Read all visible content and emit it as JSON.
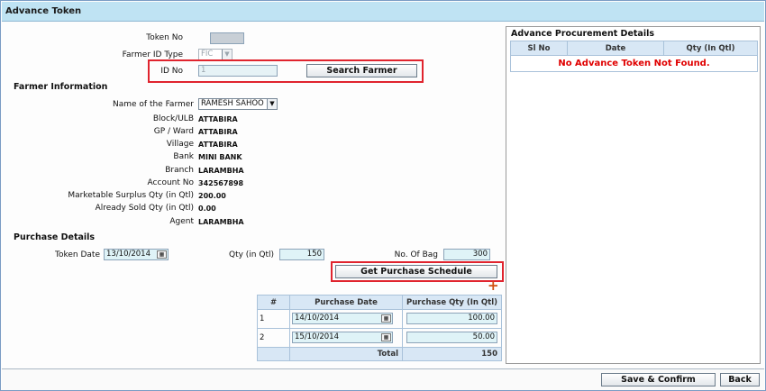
{
  "window": {
    "title": "Advance Token"
  },
  "token": {
    "label": "Token No",
    "value": ""
  },
  "farmer_id_type": {
    "label": "Farmer ID Type",
    "value": "FIC"
  },
  "id_no": {
    "label": "ID No",
    "value": "1"
  },
  "search_farmer": {
    "label": "Search Farmer"
  },
  "farmer_info": {
    "heading": "Farmer Information",
    "name_label": "Name of the Farmer",
    "name_value": "RAMESH SAHOO",
    "fields": [
      {
        "label": "Block/ULB",
        "value": "ATTABIRA"
      },
      {
        "label": "GP / Ward",
        "value": "ATTABIRA"
      },
      {
        "label": "Village",
        "value": "ATTABIRA"
      },
      {
        "label": "Bank",
        "value": "MINI BANK"
      },
      {
        "label": "Branch",
        "value": "LARAMBHA"
      },
      {
        "label": "Account No",
        "value": "342567898"
      },
      {
        "label": "Marketable Surplus Qty (in Qtl)",
        "value": "200.00"
      },
      {
        "label": "Already Sold Qty (in Qtl)",
        "value": "0.00"
      },
      {
        "label": "Agent",
        "value": "LARAMBHA"
      }
    ]
  },
  "purchase": {
    "heading": "Purchase Details",
    "token_date_label": "Token Date",
    "token_date_value": "13/10/2014",
    "qty_label": "Qty (in Qtl)",
    "qty_value": "150",
    "bags_label": "No. Of Bag",
    "bags_value": "300",
    "schedule_button": "Get Purchase Schedule"
  },
  "schedule_table": {
    "headers": [
      "#",
      "Purchase Date",
      "Purchase Qty (In Qtl)"
    ],
    "rows": [
      {
        "no": "1",
        "date": "14/10/2014",
        "qty": "100.00"
      },
      {
        "no": "2",
        "date": "15/10/2014",
        "qty": "50.00"
      }
    ],
    "total_label": "Total",
    "total_value": "150"
  },
  "procurement_panel": {
    "title": "Advance Procurement Details",
    "headers": [
      "Sl No",
      "Date",
      "Qty (In Qtl)"
    ],
    "empty_message": "No Advance Token Not Found."
  },
  "footer": {
    "save_label": "Save & Confirm",
    "back_label": "Back"
  },
  "colors": {
    "titlebar": "#bfe3f3",
    "highlight": "#e0242e",
    "error_text": "#e00000",
    "header_cell": "#d8e7f5"
  },
  "icons": {
    "calendar": "calendar-icon",
    "dropdown": "chevron-down-icon",
    "add": "plus-icon"
  }
}
